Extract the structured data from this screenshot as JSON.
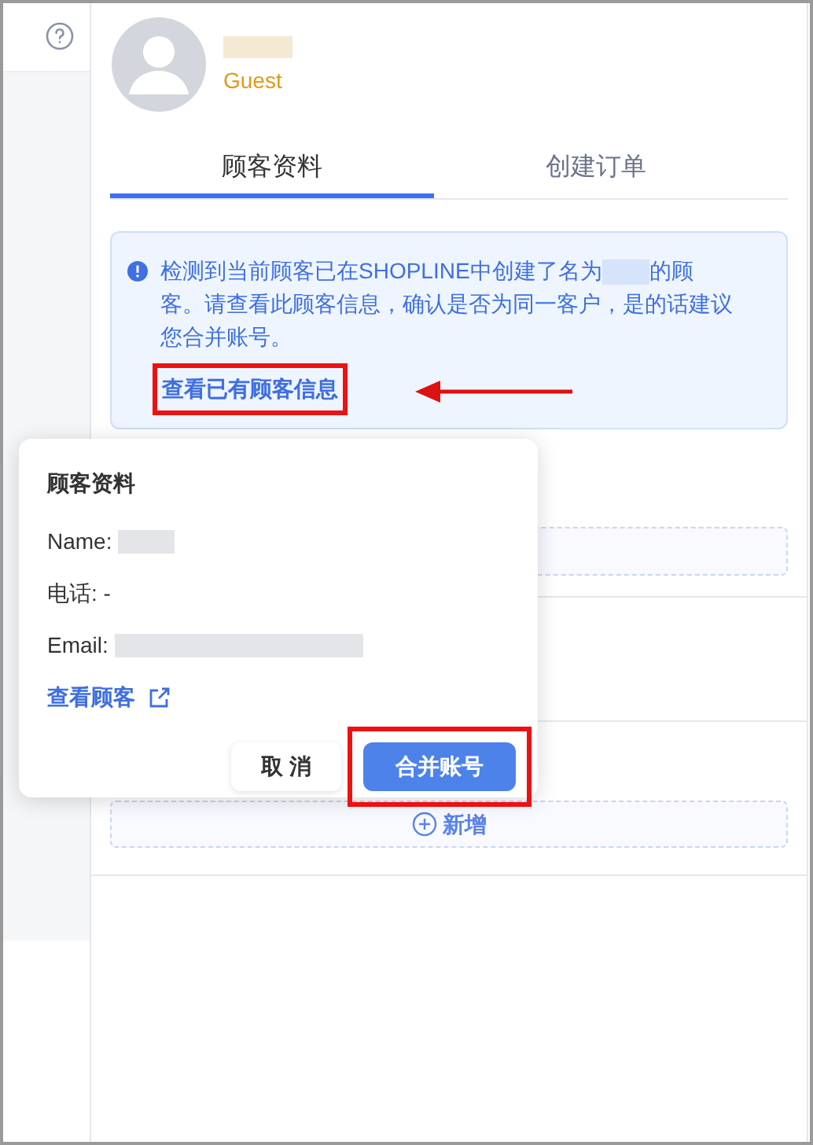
{
  "profile": {
    "badge": "Guest"
  },
  "tabs": [
    {
      "label": "顾客资料",
      "selected": true
    },
    {
      "label": "创建订单",
      "selected": false
    }
  ],
  "alert": {
    "text_before": "检测到当前顾客已在SHOPLINE中创建了名为",
    "text_after": "的顾客。请查看此顾客信息，确认是否为同一客户，是的话建议您合并账号。",
    "link": "查看已有顾客信息"
  },
  "add_button": {
    "label": "新增"
  },
  "popover": {
    "title": "顾客资料",
    "fields": [
      {
        "label": "Name:",
        "redacted": true
      },
      {
        "label": "电话: -",
        "redacted": false
      },
      {
        "label": "Email:",
        "redacted": true
      }
    ],
    "link": "查看顾客",
    "buttons": [
      {
        "label": "取 消",
        "kind": "secondary"
      },
      {
        "label": "合并账号",
        "kind": "primary"
      }
    ]
  }
}
